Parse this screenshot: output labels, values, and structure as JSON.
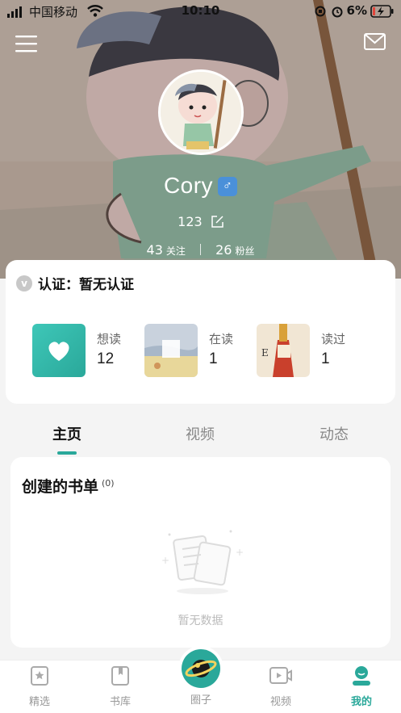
{
  "status_bar": {
    "carrier": "中国移动",
    "time": "10:10",
    "battery_percent": "6%"
  },
  "header": {
    "menu_icon": "hamburger-menu-icon",
    "mail_icon": "mail-icon"
  },
  "profile": {
    "username": "Cory",
    "gender_symbol": "♂",
    "bio": "123",
    "following_count": "43",
    "following_label": "关注",
    "followers_count": "26",
    "followers_label": "粉丝"
  },
  "certification": {
    "badge": "v",
    "text": "认证：暂无认证"
  },
  "shelves": [
    {
      "label": "想读",
      "count": "12"
    },
    {
      "label": "在读",
      "count": "1"
    },
    {
      "label": "读过",
      "count": "1"
    }
  ],
  "tabs": [
    {
      "label": "主页"
    },
    {
      "label": "视频"
    },
    {
      "label": "动态"
    }
  ],
  "booklist": {
    "title": "创建的书单",
    "count": "(0)",
    "empty_text": "暂无数据"
  },
  "bottom_nav": [
    {
      "label": "精选",
      "icon": "star-book-icon"
    },
    {
      "label": "书库",
      "icon": "bookshelf-icon"
    },
    {
      "label": "圈子",
      "icon": "planet-icon"
    },
    {
      "label": "视频",
      "icon": "video-play-icon"
    },
    {
      "label": "我的",
      "icon": "user-profile-icon"
    }
  ],
  "colors": {
    "accent": "#2aa89a",
    "gender_badge": "#4a90d9"
  }
}
